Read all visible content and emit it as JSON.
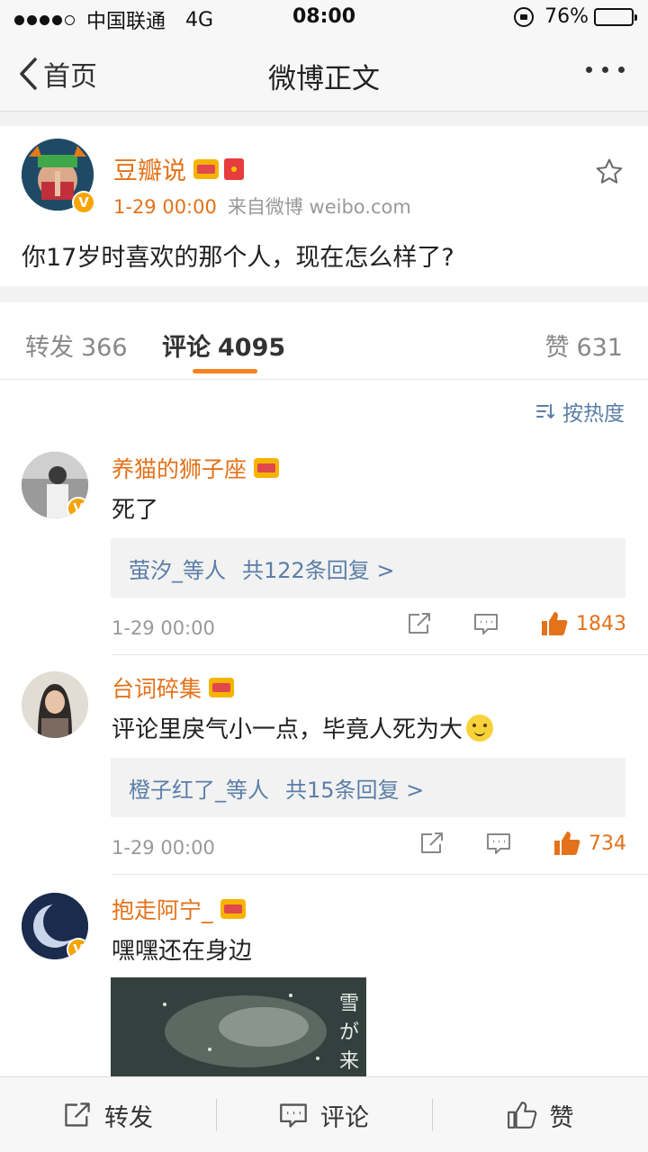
{
  "status_bar": {
    "carrier": "中国联通",
    "network": "4G",
    "time": "08:00",
    "battery": "76%",
    "battery_level": 0.76
  },
  "nav": {
    "back_label": "首页",
    "title": "微博正文"
  },
  "post": {
    "author": "豆瓣说",
    "date": "1-29 00:00",
    "source": "来自微博 weibo.com",
    "text": "你17岁时喜欢的那个人，现在怎么样了?"
  },
  "tabs": {
    "repost_label": "转发",
    "repost_count": "366",
    "comment_label": "评论",
    "comment_count": "4095",
    "like_label": "赞",
    "like_count": "631"
  },
  "sort_label": "按热度",
  "comments": [
    {
      "name": "养猫的狮子座",
      "text": "死了",
      "reply_users": "萤汐_等人",
      "reply_count": "共122条回复 >",
      "date": "1-29 00:00",
      "likes": "1843"
    },
    {
      "name": "台词碎集",
      "text": "评论里戾气小一点，毕竟人死为大",
      "reply_users": "橙子红了_等人",
      "reply_count": "共15条回复 >",
      "date": "1-29 00:00",
      "likes": "734"
    },
    {
      "name": "抱走阿宁_",
      "text": "嘿嘿还在身边",
      "image_caption": "雪が来"
    }
  ],
  "bottom_bar": {
    "repost": "转发",
    "comment": "评论",
    "like": "赞"
  },
  "colors": {
    "accent_orange": "#e3721a",
    "link_blue": "#5b7ea7",
    "tab_underline": "#f58220"
  }
}
